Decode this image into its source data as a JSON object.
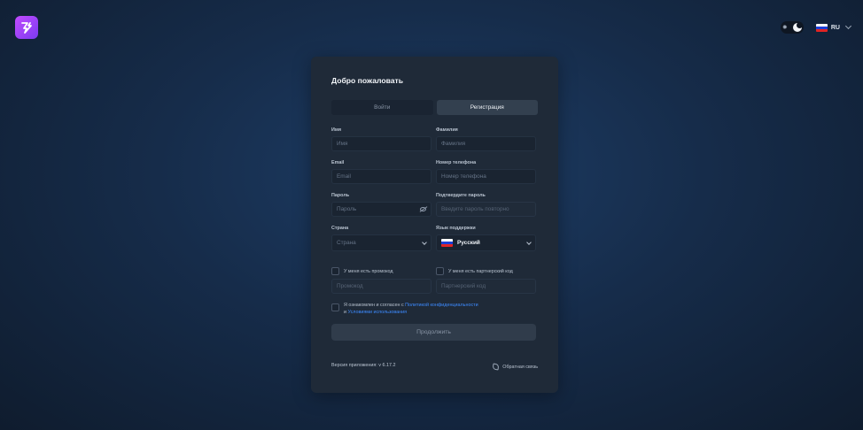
{
  "header": {
    "lang_code": "RU"
  },
  "colors": {
    "accent": "#a846ff",
    "link": "#3d8bff",
    "flag_ru": [
      "#ffffff",
      "#1c3fd6",
      "#e02424"
    ]
  },
  "card": {
    "title": "Добро пожаловать",
    "tabs": [
      {
        "label": "Войти",
        "active": false
      },
      {
        "label": "Регистрация",
        "active": true
      }
    ],
    "fields": {
      "first_name": {
        "label": "Имя",
        "placeholder": "Имя"
      },
      "last_name": {
        "label": "Фамилия",
        "placeholder": "Фамилия"
      },
      "email": {
        "label": "Email",
        "placeholder": "Email"
      },
      "phone": {
        "label": "Номер телефона",
        "placeholder": "Номер телефона"
      },
      "password": {
        "label": "Пароль",
        "placeholder": "Пароль"
      },
      "confirm_password": {
        "label": "Подтвердите пароль",
        "placeholder": "Введите пароль повторно"
      },
      "country": {
        "label": "Страна",
        "placeholder": "Страна"
      },
      "support_lang": {
        "label": "Язык поддержки",
        "value": "Русский"
      }
    },
    "promo": {
      "checkbox_label": "У меня есть промокод",
      "placeholder": "Промокод"
    },
    "partner": {
      "checkbox_label": "У меня есть партнерский код",
      "placeholder": "Партнерский код"
    },
    "agreement": {
      "prefix": "Я ознакомлен и согласен с ",
      "privacy_link": "Политикой конфиденциальности",
      "middle": "и ",
      "terms_link": "Условиями использования"
    },
    "submit_label": "Продолжить",
    "version": "Версия приложения: v 6.17.2",
    "feedback_label": "Обратная связь"
  }
}
